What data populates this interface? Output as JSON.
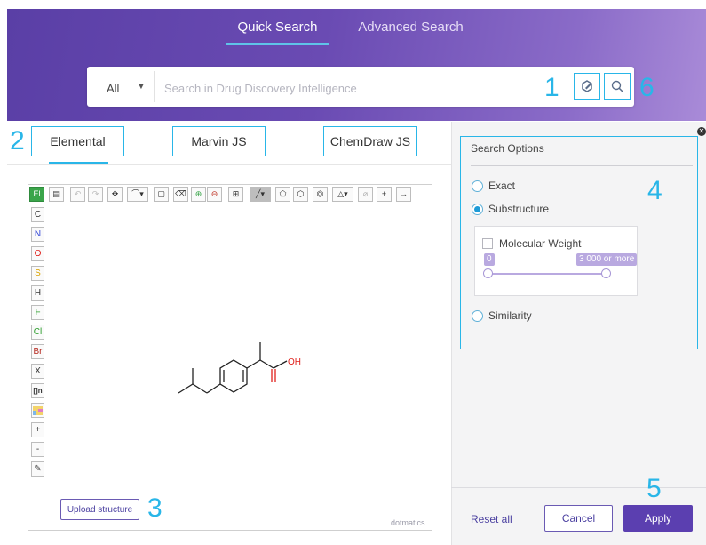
{
  "header": {
    "tabs": [
      {
        "label": "Quick Search",
        "active": true
      },
      {
        "label": "Advanced Search",
        "active": false
      }
    ]
  },
  "search": {
    "scope_value": "All",
    "placeholder": "Search in Drug Discovery Intelligence",
    "value": "",
    "draw_structure_icon": "draw-structure-icon",
    "search_icon": "search-icon"
  },
  "callouts": {
    "n1": "1",
    "n2": "2",
    "n3": "3",
    "n4": "4",
    "n5": "5",
    "n6": "6"
  },
  "editor_tabs": [
    {
      "label": "Elemental",
      "active": true
    },
    {
      "label": "Marvin JS",
      "active": false
    },
    {
      "label": "ChemDraw JS",
      "active": false
    }
  ],
  "editor": {
    "toolbar_first": "El",
    "elements": [
      "C",
      "N",
      "O",
      "S",
      "H",
      "F",
      "Cl",
      "Br"
    ],
    "element_colors": {
      "C": "#333333",
      "N": "#2b3fd6",
      "O": "#e0201b",
      "S": "#d9a300",
      "H": "#333333",
      "F": "#2a9d2a",
      "Cl": "#2a9d2a",
      "Br": "#b5281e"
    },
    "side_tools": [
      "X",
      "[]n",
      "+",
      "-"
    ],
    "molecule_label": "OH",
    "upload_label": "Upload structure",
    "brand": "dotmatics"
  },
  "options": {
    "title": "Search Options",
    "modes": [
      {
        "label": "Exact",
        "selected": false
      },
      {
        "label": "Substructure",
        "selected": true
      },
      {
        "label": "Similarity",
        "selected": false
      }
    ],
    "molecular_weight": {
      "label": "Molecular Weight",
      "checked": false,
      "min_label": "0",
      "max_label": "3 000 or more"
    }
  },
  "footer": {
    "reset_label": "Reset all",
    "cancel_label": "Cancel",
    "apply_label": "Apply"
  },
  "colors": {
    "accent": "#29b6e8",
    "brand_purple": "#5b3fb0",
    "header_gradient_start": "#5a3fa6"
  }
}
